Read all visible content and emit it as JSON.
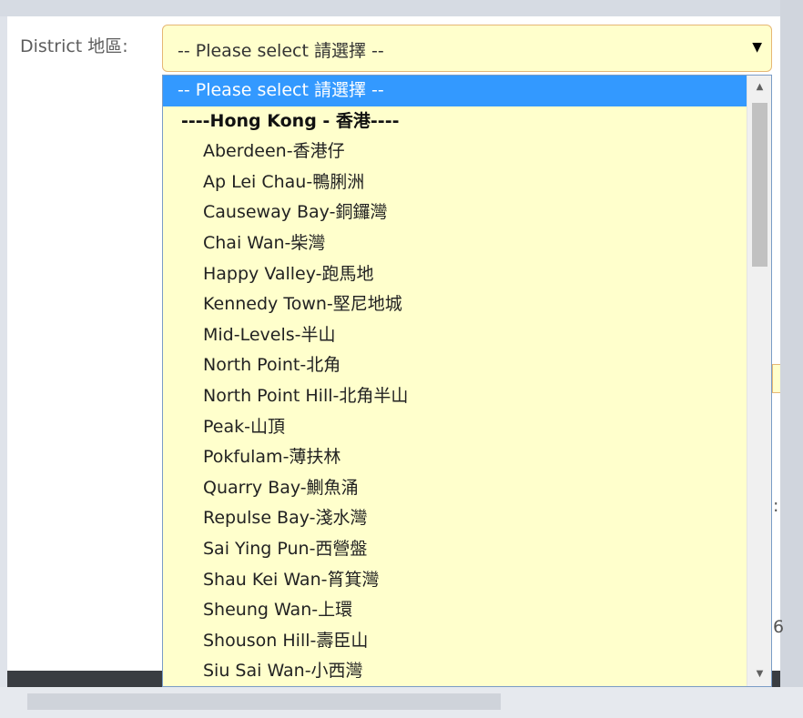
{
  "form": {
    "district_label": "District 地區:",
    "select": {
      "value": "-- Please select 請選擇 --",
      "caret": "▼"
    }
  },
  "dropdown": {
    "options": [
      {
        "label": "-- Please select 請選擇 --",
        "type": "selected"
      },
      {
        "label": "----Hong Kong - 香港----",
        "type": "group"
      },
      {
        "label": "Aberdeen-香港仔",
        "type": "option"
      },
      {
        "label": "Ap Lei Chau-鴨脷洲",
        "type": "option"
      },
      {
        "label": "Causeway Bay-銅鑼灣",
        "type": "option"
      },
      {
        "label": "Chai Wan-柴灣",
        "type": "option"
      },
      {
        "label": "Happy Valley-跑馬地",
        "type": "option"
      },
      {
        "label": "Kennedy Town-堅尼地城",
        "type": "option"
      },
      {
        "label": "Mid-Levels-半山",
        "type": "option"
      },
      {
        "label": "North Point-北角",
        "type": "option"
      },
      {
        "label": "North Point Hill-北角半山",
        "type": "option"
      },
      {
        "label": "Peak-山頂",
        "type": "option"
      },
      {
        "label": "Pokfulam-薄扶林",
        "type": "option"
      },
      {
        "label": "Quarry Bay-鰂魚涌",
        "type": "option"
      },
      {
        "label": "Repulse Bay-淺水灣",
        "type": "option"
      },
      {
        "label": "Sai Ying Pun-西營盤",
        "type": "option"
      },
      {
        "label": "Shau Kei Wan-筲箕灣",
        "type": "option"
      },
      {
        "label": "Sheung Wan-上環",
        "type": "option"
      },
      {
        "label": "Shouson Hill-壽臣山",
        "type": "option"
      },
      {
        "label": "Siu Sai Wan-小西灣",
        "type": "option"
      }
    ],
    "scroll_up_icon": "▲",
    "scroll_down_icon": "▼"
  },
  "edge_fragments": {
    "colon": ":",
    "digit": "6"
  },
  "colors": {
    "field_background": "#ffffcc",
    "selected_highlight": "#3399ff",
    "field_border": "#e6b774"
  }
}
